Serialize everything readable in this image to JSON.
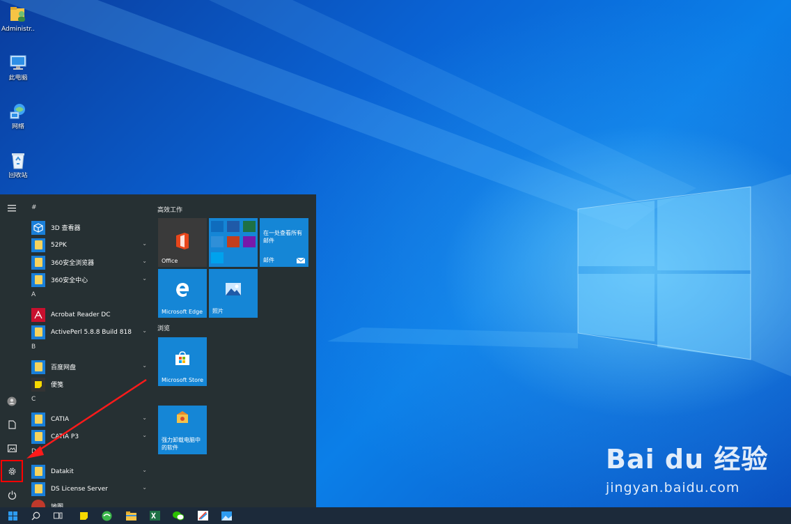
{
  "desktop": {
    "icons": [
      {
        "label": "Administr...",
        "icon": "user-folder-icon"
      },
      {
        "label": "此电脑",
        "icon": "computer-icon"
      },
      {
        "label": "网络",
        "icon": "network-icon"
      },
      {
        "label": "回收站",
        "icon": "recycle-bin-icon"
      }
    ]
  },
  "start_menu": {
    "rail": {
      "icons": [
        "hamburger-menu-icon",
        "user-account-icon",
        "documents-icon",
        "pictures-icon",
        "settings-gear-icon",
        "power-icon"
      ]
    },
    "app_list": [
      {
        "type": "header",
        "label": "#"
      },
      {
        "type": "app",
        "label": "3D 查看器",
        "icon": "3d-viewer-icon"
      },
      {
        "type": "app",
        "label": "52PK",
        "icon": "folder-icon",
        "expandable": true
      },
      {
        "type": "app",
        "label": "360安全浏览器",
        "icon": "folder-icon",
        "expandable": true
      },
      {
        "type": "app",
        "label": "360安全中心",
        "icon": "folder-icon",
        "expandable": true
      },
      {
        "type": "header",
        "label": "A"
      },
      {
        "type": "app",
        "label": "Acrobat Reader DC",
        "icon": "acrobat-icon"
      },
      {
        "type": "app",
        "label": "ActivePerl 5.8.8 Build 818",
        "icon": "folder-icon",
        "expandable": true
      },
      {
        "type": "header",
        "label": "B"
      },
      {
        "type": "app",
        "label": "百度网盘",
        "icon": "folder-icon",
        "expandable": true
      },
      {
        "type": "app",
        "label": "便笺",
        "icon": "sticky-notes-icon"
      },
      {
        "type": "header",
        "label": "C"
      },
      {
        "type": "app",
        "label": "CATIA",
        "icon": "folder-icon",
        "expandable": true
      },
      {
        "type": "app",
        "label": "CATIA P3",
        "icon": "folder-icon",
        "expandable": true
      },
      {
        "type": "header",
        "label": "D"
      },
      {
        "type": "app",
        "label": "Datakit",
        "icon": "folder-icon",
        "expandable": true
      },
      {
        "type": "app",
        "label": "DS License Server",
        "icon": "folder-icon",
        "expandable": true
      },
      {
        "type": "app",
        "label": "地图",
        "icon": "maps-icon"
      }
    ],
    "tile_groups": {
      "productivity": "高效工作",
      "browse": "浏览"
    },
    "tiles": {
      "office": "Office",
      "mail_text": "在一处查看所有邮件",
      "mail": "邮件",
      "edge": "Microsoft Edge",
      "photos": "照片",
      "store": "Microsoft Store",
      "uninstall": "强力卸载电脑中的软件"
    }
  },
  "taskbar": {
    "icons": [
      "windows-start-icon",
      "search-icon",
      "task-view-icon",
      "sticky-notes-icon",
      "360-browser-icon",
      "file-explorer-icon",
      "excel-icon",
      "wechat-icon",
      "paint-app-icon",
      "photos-app-icon"
    ]
  },
  "watermark": {
    "brand": "Bai du 经验",
    "url": "jingyan.baidu.com"
  },
  "colors": {
    "accent": "#1586d6",
    "menu_bg": "#263033",
    "highlight": "#ff0000"
  }
}
